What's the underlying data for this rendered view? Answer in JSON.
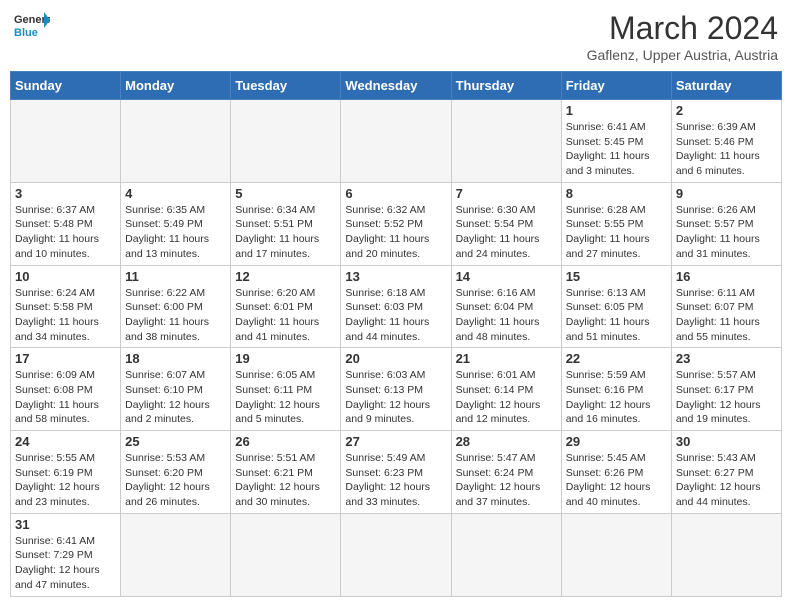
{
  "header": {
    "logo_text_general": "General",
    "logo_text_blue": "Blue",
    "title": "March 2024",
    "subtitle": "Gaflenz, Upper Austria, Austria"
  },
  "calendar": {
    "days_of_week": [
      "Sunday",
      "Monday",
      "Tuesday",
      "Wednesday",
      "Thursday",
      "Friday",
      "Saturday"
    ],
    "weeks": [
      [
        {
          "day": "",
          "info": ""
        },
        {
          "day": "",
          "info": ""
        },
        {
          "day": "",
          "info": ""
        },
        {
          "day": "",
          "info": ""
        },
        {
          "day": "",
          "info": ""
        },
        {
          "day": "1",
          "info": "Sunrise: 6:41 AM\nSunset: 5:45 PM\nDaylight: 11 hours\nand 3 minutes."
        },
        {
          "day": "2",
          "info": "Sunrise: 6:39 AM\nSunset: 5:46 PM\nDaylight: 11 hours\nand 6 minutes."
        }
      ],
      [
        {
          "day": "3",
          "info": "Sunrise: 6:37 AM\nSunset: 5:48 PM\nDaylight: 11 hours\nand 10 minutes."
        },
        {
          "day": "4",
          "info": "Sunrise: 6:35 AM\nSunset: 5:49 PM\nDaylight: 11 hours\nand 13 minutes."
        },
        {
          "day": "5",
          "info": "Sunrise: 6:34 AM\nSunset: 5:51 PM\nDaylight: 11 hours\nand 17 minutes."
        },
        {
          "day": "6",
          "info": "Sunrise: 6:32 AM\nSunset: 5:52 PM\nDaylight: 11 hours\nand 20 minutes."
        },
        {
          "day": "7",
          "info": "Sunrise: 6:30 AM\nSunset: 5:54 PM\nDaylight: 11 hours\nand 24 minutes."
        },
        {
          "day": "8",
          "info": "Sunrise: 6:28 AM\nSunset: 5:55 PM\nDaylight: 11 hours\nand 27 minutes."
        },
        {
          "day": "9",
          "info": "Sunrise: 6:26 AM\nSunset: 5:57 PM\nDaylight: 11 hours\nand 31 minutes."
        }
      ],
      [
        {
          "day": "10",
          "info": "Sunrise: 6:24 AM\nSunset: 5:58 PM\nDaylight: 11 hours\nand 34 minutes."
        },
        {
          "day": "11",
          "info": "Sunrise: 6:22 AM\nSunset: 6:00 PM\nDaylight: 11 hours\nand 38 minutes."
        },
        {
          "day": "12",
          "info": "Sunrise: 6:20 AM\nSunset: 6:01 PM\nDaylight: 11 hours\nand 41 minutes."
        },
        {
          "day": "13",
          "info": "Sunrise: 6:18 AM\nSunset: 6:03 PM\nDaylight: 11 hours\nand 44 minutes."
        },
        {
          "day": "14",
          "info": "Sunrise: 6:16 AM\nSunset: 6:04 PM\nDaylight: 11 hours\nand 48 minutes."
        },
        {
          "day": "15",
          "info": "Sunrise: 6:13 AM\nSunset: 6:05 PM\nDaylight: 11 hours\nand 51 minutes."
        },
        {
          "day": "16",
          "info": "Sunrise: 6:11 AM\nSunset: 6:07 PM\nDaylight: 11 hours\nand 55 minutes."
        }
      ],
      [
        {
          "day": "17",
          "info": "Sunrise: 6:09 AM\nSunset: 6:08 PM\nDaylight: 11 hours\nand 58 minutes."
        },
        {
          "day": "18",
          "info": "Sunrise: 6:07 AM\nSunset: 6:10 PM\nDaylight: 12 hours\nand 2 minutes."
        },
        {
          "day": "19",
          "info": "Sunrise: 6:05 AM\nSunset: 6:11 PM\nDaylight: 12 hours\nand 5 minutes."
        },
        {
          "day": "20",
          "info": "Sunrise: 6:03 AM\nSunset: 6:13 PM\nDaylight: 12 hours\nand 9 minutes."
        },
        {
          "day": "21",
          "info": "Sunrise: 6:01 AM\nSunset: 6:14 PM\nDaylight: 12 hours\nand 12 minutes."
        },
        {
          "day": "22",
          "info": "Sunrise: 5:59 AM\nSunset: 6:16 PM\nDaylight: 12 hours\nand 16 minutes."
        },
        {
          "day": "23",
          "info": "Sunrise: 5:57 AM\nSunset: 6:17 PM\nDaylight: 12 hours\nand 19 minutes."
        }
      ],
      [
        {
          "day": "24",
          "info": "Sunrise: 5:55 AM\nSunset: 6:19 PM\nDaylight: 12 hours\nand 23 minutes."
        },
        {
          "day": "25",
          "info": "Sunrise: 5:53 AM\nSunset: 6:20 PM\nDaylight: 12 hours\nand 26 minutes."
        },
        {
          "day": "26",
          "info": "Sunrise: 5:51 AM\nSunset: 6:21 PM\nDaylight: 12 hours\nand 30 minutes."
        },
        {
          "day": "27",
          "info": "Sunrise: 5:49 AM\nSunset: 6:23 PM\nDaylight: 12 hours\nand 33 minutes."
        },
        {
          "day": "28",
          "info": "Sunrise: 5:47 AM\nSunset: 6:24 PM\nDaylight: 12 hours\nand 37 minutes."
        },
        {
          "day": "29",
          "info": "Sunrise: 5:45 AM\nSunset: 6:26 PM\nDaylight: 12 hours\nand 40 minutes."
        },
        {
          "day": "30",
          "info": "Sunrise: 5:43 AM\nSunset: 6:27 PM\nDaylight: 12 hours\nand 44 minutes."
        }
      ],
      [
        {
          "day": "31",
          "info": "Sunrise: 6:41 AM\nSunset: 7:29 PM\nDaylight: 12 hours\nand 47 minutes."
        },
        {
          "day": "",
          "info": ""
        },
        {
          "day": "",
          "info": ""
        },
        {
          "day": "",
          "info": ""
        },
        {
          "day": "",
          "info": ""
        },
        {
          "day": "",
          "info": ""
        },
        {
          "day": "",
          "info": ""
        }
      ]
    ]
  }
}
